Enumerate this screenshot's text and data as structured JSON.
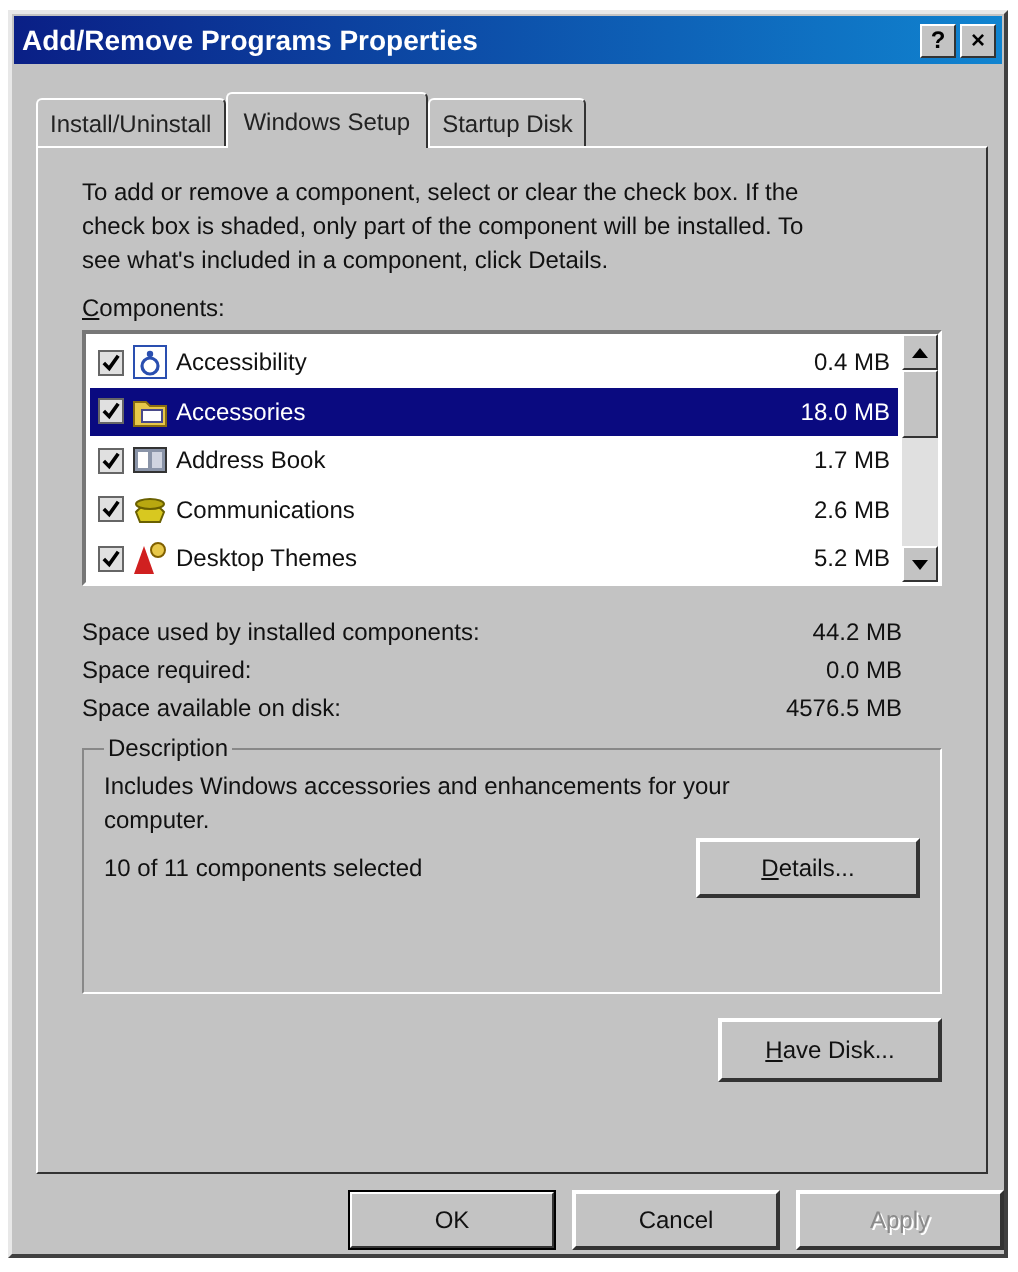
{
  "window": {
    "title": "Add/Remove Programs Properties",
    "title_buttons": [
      "?",
      "×"
    ]
  },
  "tabs": [
    {
      "label": "Install/Uninstall",
      "selected": false
    },
    {
      "label": "Windows Setup",
      "selected": true
    },
    {
      "label": "Startup Disk",
      "selected": false
    }
  ],
  "instructions": "To add or remove a component, select or clear the check box. If the check box is shaded, only part of the component will be installed. To see what's included in a component, click Details.",
  "components_label": {
    "text": "Components:",
    "access_key": true
  },
  "components": [
    {
      "name": "Accessibility",
      "size": "0.4 MB",
      "checked": true,
      "selected": false
    },
    {
      "name": "Accessories",
      "size": "18.0 MB",
      "checked": true,
      "selected": true
    },
    {
      "name": "Address Book",
      "size": "1.7 MB",
      "checked": true,
      "selected": false
    },
    {
      "name": "Communications",
      "size": "2.6 MB",
      "checked": true,
      "selected": false
    },
    {
      "name": "Desktop Themes",
      "size": "5.2 MB",
      "checked": true,
      "selected": false
    }
  ],
  "space": [
    {
      "label": "Space used by installed components:",
      "value": "44.2 MB"
    },
    {
      "label": "Space required:",
      "value": "0.0 MB"
    },
    {
      "label": "Space available on disk:",
      "value": "4576.5 MB"
    }
  ],
  "description": {
    "title": "Description",
    "text": "Includes Windows accessories and enhancements for your computer.",
    "count": "10 of 11 components selected",
    "details_button": {
      "label": "Details...",
      "access_key": true
    }
  },
  "have_disk_button": {
    "label": "Have Disk...",
    "access_key": true
  },
  "buttons": [
    {
      "label": "OK",
      "default": true,
      "disabled": false
    },
    {
      "label": "Cancel",
      "default": false,
      "disabled": false
    },
    {
      "label": "Apply",
      "default": false,
      "disabled": true
    }
  ]
}
